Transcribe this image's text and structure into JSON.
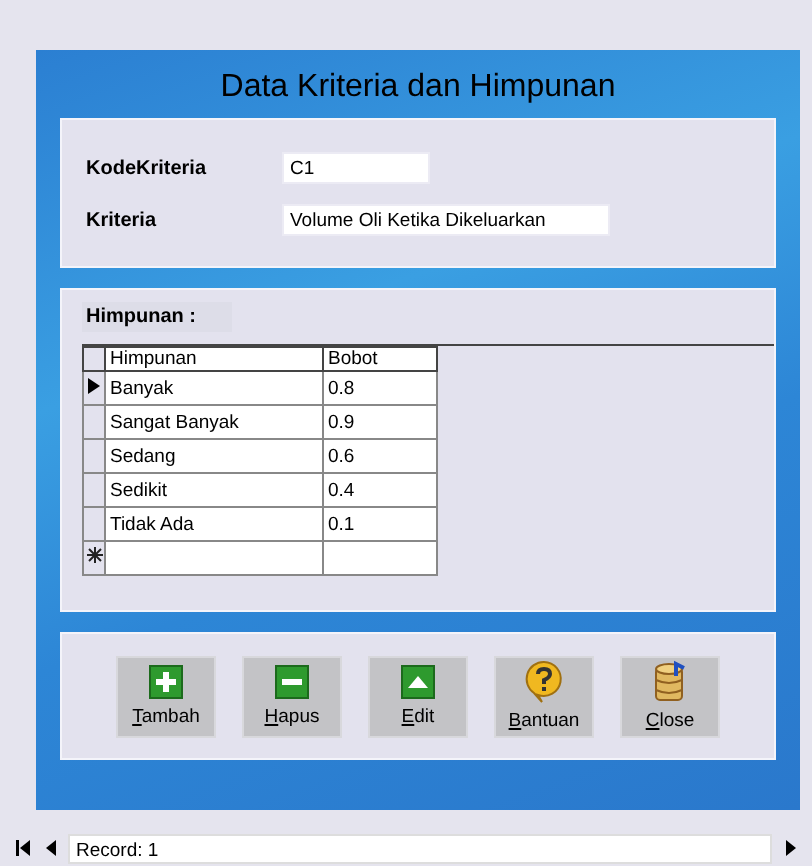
{
  "window": {
    "title": "Data Kriteria dan Himpunan"
  },
  "fields": [
    {
      "label": "KodeKriteria",
      "value": "C1"
    },
    {
      "label": "Kriteria",
      "value": "Volume Oli Ketika Dikeluarkan"
    }
  ],
  "himpunan": {
    "label": "Himpunan :",
    "columns": [
      "Himpunan",
      "Bobot"
    ],
    "rows": [
      {
        "himpunan": "Banyak",
        "bobot": "0.8",
        "selected": true
      },
      {
        "himpunan": "Sangat Banyak",
        "bobot": "0.9",
        "selected": false
      },
      {
        "himpunan": "Sedang",
        "bobot": "0.6",
        "selected": false
      },
      {
        "himpunan": "Sedikit",
        "bobot": "0.4",
        "selected": false
      },
      {
        "himpunan": "Tidak Ada",
        "bobot": "0.1",
        "selected": false
      }
    ]
  },
  "buttons": [
    {
      "label": "Tambah",
      "kind": "add"
    },
    {
      "label": "Hapus",
      "kind": "remove"
    },
    {
      "label": "Edit",
      "kind": "edit"
    },
    {
      "label": "Bantuan",
      "kind": "help"
    },
    {
      "label": "Close",
      "kind": "close"
    }
  ],
  "navigator": {
    "record": "Record: 1"
  }
}
